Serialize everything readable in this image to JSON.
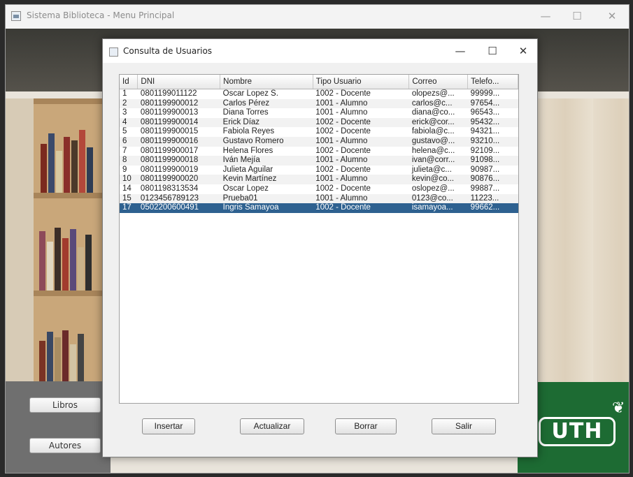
{
  "main_window": {
    "title": "Sistema Biblioteca - Menu Principal",
    "minimize_glyph": "—",
    "maximize_glyph": "☐",
    "close_glyph": "✕",
    "buttons": {
      "libros": "Libros",
      "autores": "Autores"
    },
    "logo_text": "UTH"
  },
  "dialog": {
    "title": "Consulta de Usuarios",
    "minimize_glyph": "—",
    "maximize_glyph": "☐",
    "close_glyph": "✕",
    "table": {
      "columns": [
        "Id",
        "DNI",
        "Nombre",
        "Tipo Usuario",
        "Correo",
        "Telefo..."
      ],
      "rows": [
        [
          "1",
          "0801199011122",
          "Oscar Lopez S.",
          "1002 - Docente",
          "olopezs@...",
          "99999..."
        ],
        [
          "2",
          "0801199900012",
          "Carlos Pérez",
          "1001 - Alumno",
          "carlos@c...",
          "97654..."
        ],
        [
          "3",
          "0801199900013",
          "Diana Torres",
          "1001 - Alumno",
          "diana@co...",
          "96543..."
        ],
        [
          "4",
          "0801199900014",
          "Erick Díaz",
          "1002 - Docente",
          "erick@cor...",
          "95432..."
        ],
        [
          "5",
          "0801199900015",
          "Fabiola Reyes",
          "1002 - Docente",
          "fabiola@c...",
          "94321..."
        ],
        [
          "6",
          "0801199900016",
          "Gustavo Romero",
          "1001 - Alumno",
          "gustavo@...",
          "93210..."
        ],
        [
          "7",
          "0801199900017",
          "Helena Flores",
          "1002 - Docente",
          "helena@c...",
          "92109..."
        ],
        [
          "8",
          "0801199900018",
          "Iván Mejía",
          "1001 - Alumno",
          "ivan@corr...",
          "91098..."
        ],
        [
          "9",
          "0801199900019",
          "Julieta Aguilar",
          "1002 - Docente",
          "julieta@c...",
          "90987..."
        ],
        [
          "10",
          "0801199900020",
          "Kevin Martínez",
          "1001 - Alumno",
          "kevin@co...",
          "90876..."
        ],
        [
          "14",
          "0801198313534",
          "Oscar Lopez",
          "1002 - Docente",
          "oslopez@...",
          "99887..."
        ],
        [
          "15",
          "0123456789123",
          "Prueba01",
          "1001 - Alumno",
          "0123@co...",
          "11223..."
        ],
        [
          "17",
          "0502200600491",
          "Ingris Samayoa",
          "1002 - Docente",
          "isamayoa...",
          "99662..."
        ]
      ],
      "selected_row": 12
    },
    "buttons": {
      "insertar": "Insertar",
      "actualizar": "Actualizar",
      "borrar": "Borrar",
      "salir": "Salir"
    }
  }
}
